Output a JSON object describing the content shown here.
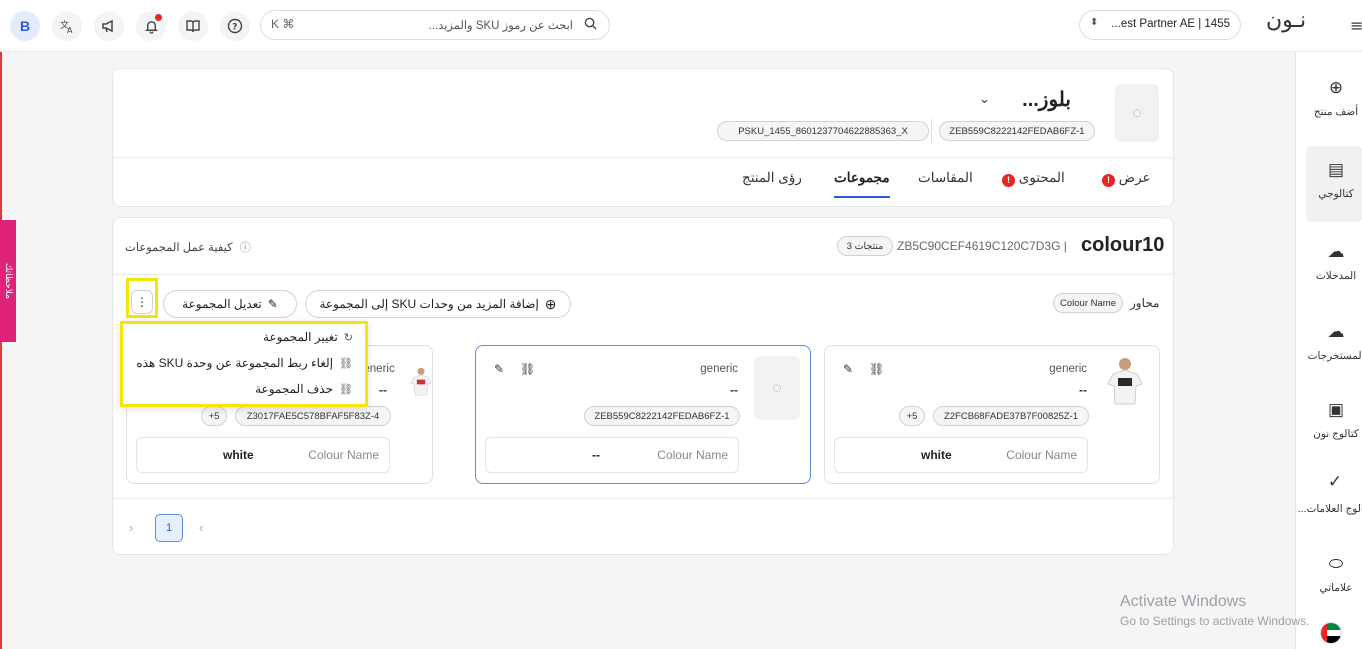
{
  "topbar": {
    "avatar": "B",
    "search_key": "K ⌘",
    "search_placeholder": "ابحث عن رموز SKU والمزيد...",
    "partner": "...est Partner AE | 1455",
    "logo": "نـون"
  },
  "sidebar": {
    "items": [
      {
        "label": "أضف منتج",
        "icon": "plus-circle-icon"
      },
      {
        "label": "كتالوجي",
        "icon": "catalog-icon"
      },
      {
        "label": "المدخلات",
        "icon": "upload-cloud-icon"
      },
      {
        "label": "المستخرجات",
        "icon": "download-cloud-icon"
      },
      {
        "label": "كتالوج نون",
        "icon": "noon-catalog-icon"
      },
      {
        "label": "كتالوج العلامات...",
        "icon": "verified-badge-icon"
      },
      {
        "label": "علاماتي",
        "icon": "tag-icon"
      }
    ]
  },
  "feedback_label": "ملاحظاتك",
  "product": {
    "title": "بلوز...",
    "zsku": "ZEB559C8222142FEDAB6FZ-1",
    "psku": "PSKU_1455_8601237704622885363_X"
  },
  "tabs": [
    {
      "label": "عرض",
      "error": true
    },
    {
      "label": "المحتوى",
      "error": true
    },
    {
      "label": "المقاسات",
      "error": false
    },
    {
      "label": "مجموعات",
      "error": false,
      "active": true
    },
    {
      "label": "رؤى المنتج",
      "error": false
    }
  ],
  "group": {
    "name": "colour10",
    "code": "ZB5C90CEF4619C120C7D3G |",
    "count": "3 منتجات",
    "how_it_works": "كيفية عمل المجموعات",
    "axes_label": "محاور",
    "axis_chip": "Colour Name",
    "add_more": "إضافة المزيد من وحدات SKU إلى المجموعة",
    "edit": "تعديل المجموعة",
    "more": "⋮"
  },
  "menu": {
    "change": "تغيير المجموعة",
    "unlink": "إلغاء ربط المجموعة عن وحدة SKU هذه",
    "delete": "حذف المجموعة"
  },
  "skus": [
    {
      "brand": "generic",
      "title": "--",
      "sku": "Z2FCB68FADE37B7F00825Z-1",
      "more": "+5",
      "attr_label": "Colour Name",
      "attr_value": "white"
    },
    {
      "brand": "generic",
      "title": "--",
      "sku": "ZEB559C8222142FEDAB6FZ-1",
      "attr_label": "Colour Name",
      "attr_value": "--"
    },
    {
      "brand": "generic",
      "title": "--",
      "sku": "Z3017FAE5C578BFAF5F83Z-4",
      "more": "+5",
      "attr_label": "Colour Name",
      "attr_value": "white"
    }
  ],
  "pagination": {
    "current": "1"
  },
  "watermark": {
    "title": "Activate Windows",
    "subtitle": "Go to Settings to activate Windows."
  },
  "colors": {
    "accent": "#2d5bd7",
    "error": "#e22222",
    "highlight": "#f5e50b",
    "feedback": "#e0237a"
  }
}
